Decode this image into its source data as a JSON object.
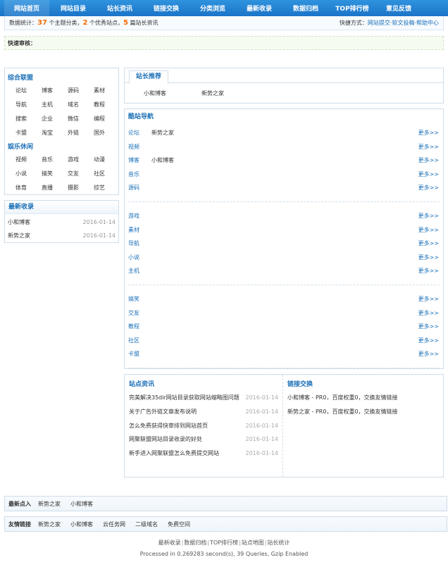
{
  "nav": [
    "网站首页",
    "网站目录",
    "站长资讯",
    "链接交换",
    "分类浏览",
    "最新收录",
    "数据归档",
    "TOP排行榜",
    "意见反馈"
  ],
  "stats": {
    "prefix": "数据统计：",
    "cat_count": "37",
    "cat_label": "个主题分类，",
    "site_count": "2",
    "site_label": "个优秀站点，",
    "article_count": "5",
    "article_label": "篇站长资讯",
    "quick_label": "快捷方式：",
    "links": [
      "网站提交",
      "软文投稿",
      "帮助中心"
    ],
    "sep": "·"
  },
  "quick_review": "快速审核：",
  "left": {
    "groups": [
      {
        "title": "综合联盟",
        "items": [
          "论坛",
          "博客",
          "源码",
          "素材",
          "导航",
          "主机",
          "域名",
          "教程",
          "搜索",
          "企业",
          "微信",
          "编程",
          "卡盟",
          "淘宝",
          "外链",
          "国外"
        ]
      },
      {
        "title": "娱乐休闲",
        "items": [
          "视频",
          "音乐",
          "游戏",
          "动漫",
          "小说",
          "搞笑",
          "交友",
          "社区",
          "体育",
          "直播",
          "摄影",
          "综艺"
        ]
      }
    ],
    "latest": {
      "title": "最新收录",
      "items": [
        {
          "name": "小和博客",
          "date": "2016-01-14"
        },
        {
          "name": "新势之家",
          "date": "2016-01-14"
        }
      ]
    }
  },
  "recommend": {
    "title": "站长推荐",
    "items": [
      "小和博客",
      "新势之家"
    ]
  },
  "cool": {
    "title": "酷站导航",
    "more": "更多>>",
    "groups": [
      [
        {
          "name": "论坛",
          "sites": "新势之家"
        },
        {
          "name": "视频",
          "sites": ""
        },
        {
          "name": "博客",
          "sites": "小和博客"
        },
        {
          "name": "音乐",
          "sites": ""
        },
        {
          "name": "源码",
          "sites": ""
        }
      ],
      [
        {
          "name": "游戏",
          "sites": ""
        },
        {
          "name": "素材",
          "sites": ""
        },
        {
          "name": "导航",
          "sites": ""
        },
        {
          "name": "小说",
          "sites": ""
        },
        {
          "name": "主机",
          "sites": ""
        }
      ],
      [
        {
          "name": "搞笑",
          "sites": ""
        },
        {
          "name": "交友",
          "sites": ""
        },
        {
          "name": "教程",
          "sites": ""
        },
        {
          "name": "社区",
          "sites": ""
        },
        {
          "name": "卡盟",
          "sites": ""
        }
      ]
    ]
  },
  "news": {
    "title": "站点资讯",
    "items": [
      {
        "t": "完美解决35dir网站目录获取网站缩略图问题",
        "d": "2016-01-14"
      },
      {
        "t": "关于广告外链文章发布说明",
        "d": "2016-01-14"
      },
      {
        "t": "怎么免费获得快审排到网站首页",
        "d": "2016-01-14"
      },
      {
        "t": "网聚联盟网站目录收录的好处",
        "d": "2016-01-14"
      },
      {
        "t": "新手进入网聚联盟怎么免费提交网站",
        "d": "2016-01-14"
      }
    ]
  },
  "exchange": {
    "title": "链接交换",
    "items": [
      "小和博客 - PR0，百度权重0，交换友情链接",
      "新势之家 - PR0，百度权重0，交换友情链接"
    ]
  },
  "hot": {
    "label": "最新点入",
    "items": [
      "新势之家",
      "小和博客"
    ]
  },
  "friends": {
    "label": "友情链接",
    "items": [
      "新势之家",
      "小和博客",
      "云任务网",
      "二级域名",
      "免费空间"
    ]
  },
  "footer": {
    "links": [
      "最新收录",
      "数据归档",
      "TOP排行榜",
      "站点地图",
      "站长统计"
    ],
    "sep": "|",
    "processed": "Processed in 0.269283 second(s), 39 Queries, Gzip Enabled"
  }
}
